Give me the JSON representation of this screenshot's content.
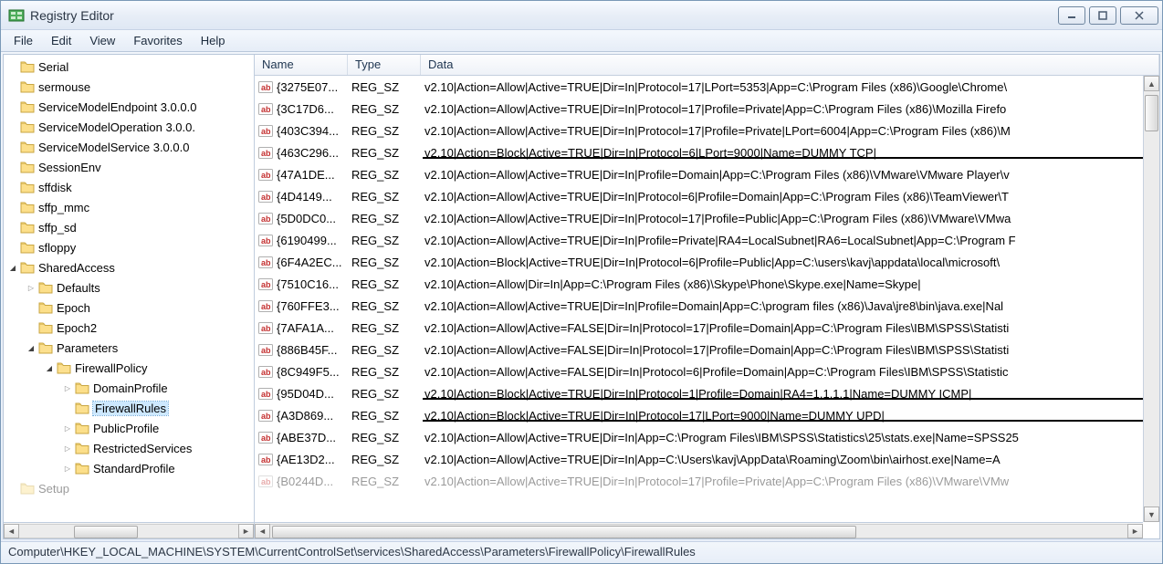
{
  "window": {
    "title": "Registry Editor"
  },
  "menubar": [
    "File",
    "Edit",
    "View",
    "Favorites",
    "Help"
  ],
  "tree": [
    {
      "depth": 1,
      "exp": "",
      "label": "Serial"
    },
    {
      "depth": 1,
      "exp": "",
      "label": "sermouse"
    },
    {
      "depth": 1,
      "exp": "",
      "label": "ServiceModelEndpoint 3.0.0.0"
    },
    {
      "depth": 1,
      "exp": "",
      "label": "ServiceModelOperation 3.0.0."
    },
    {
      "depth": 1,
      "exp": "",
      "label": "ServiceModelService 3.0.0.0"
    },
    {
      "depth": 1,
      "exp": "",
      "label": "SessionEnv"
    },
    {
      "depth": 1,
      "exp": "",
      "label": "sffdisk"
    },
    {
      "depth": 1,
      "exp": "",
      "label": "sffp_mmc"
    },
    {
      "depth": 1,
      "exp": "",
      "label": "sffp_sd"
    },
    {
      "depth": 1,
      "exp": "",
      "label": "sfloppy"
    },
    {
      "depth": 1,
      "exp": "▾",
      "label": "SharedAccess"
    },
    {
      "depth": 2,
      "exp": "▸",
      "label": "Defaults"
    },
    {
      "depth": 2,
      "exp": "",
      "label": "Epoch"
    },
    {
      "depth": 2,
      "exp": "",
      "label": "Epoch2"
    },
    {
      "depth": 2,
      "exp": "▾",
      "label": "Parameters"
    },
    {
      "depth": 3,
      "exp": "▾",
      "label": "FirewallPolicy"
    },
    {
      "depth": 4,
      "exp": "▸",
      "label": "DomainProfile"
    },
    {
      "depth": 4,
      "exp": "",
      "label": "FirewallRules",
      "selected": true
    },
    {
      "depth": 4,
      "exp": "▸",
      "label": "PublicProfile"
    },
    {
      "depth": 4,
      "exp": "▸",
      "label": "RestrictedServices"
    },
    {
      "depth": 4,
      "exp": "▸",
      "label": "StandardProfile"
    },
    {
      "depth": 1,
      "exp": "",
      "label": "Setup",
      "faded": true
    }
  ],
  "list": {
    "columns": [
      "Name",
      "Type",
      "Data"
    ],
    "rows": [
      {
        "name": "{3275E07...",
        "type": "REG_SZ",
        "data": "v2.10|Action=Allow|Active=TRUE|Dir=In|Protocol=17|LPort=5353|App=C:\\Program Files (x86)\\Google\\Chrome\\"
      },
      {
        "name": "{3C17D6...",
        "type": "REG_SZ",
        "data": "v2.10|Action=Allow|Active=TRUE|Dir=In|Protocol=17|Profile=Private|App=C:\\Program Files (x86)\\Mozilla Firefo"
      },
      {
        "name": "{403C394...",
        "type": "REG_SZ",
        "data": "v2.10|Action=Allow|Active=TRUE|Dir=In|Protocol=17|Profile=Private|LPort=6004|App=C:\\Program Files (x86)\\M"
      },
      {
        "name": "{463C296...",
        "type": "REG_SZ",
        "data": "v2.10|Action=Block|Active=TRUE|Dir=In|Protocol=6|LPort=9000|Name=DUMMY TCP|",
        "underlined": true
      },
      {
        "name": "{47A1DE...",
        "type": "REG_SZ",
        "data": "v2.10|Action=Allow|Active=TRUE|Dir=In|Profile=Domain|App=C:\\Program Files (x86)\\VMware\\VMware Player\\v"
      },
      {
        "name": "{4D4149...",
        "type": "REG_SZ",
        "data": "v2.10|Action=Allow|Active=TRUE|Dir=In|Protocol=6|Profile=Domain|App=C:\\Program Files (x86)\\TeamViewer\\T"
      },
      {
        "name": "{5D0DC0...",
        "type": "REG_SZ",
        "data": "v2.10|Action=Allow|Active=TRUE|Dir=In|Protocol=17|Profile=Public|App=C:\\Program Files (x86)\\VMware\\VMwa"
      },
      {
        "name": "{6190499...",
        "type": "REG_SZ",
        "data": "v2.10|Action=Allow|Active=TRUE|Dir=In|Profile=Private|RA4=LocalSubnet|RA6=LocalSubnet|App=C:\\Program F"
      },
      {
        "name": "{6F4A2EC...",
        "type": "REG_SZ",
        "data": "v2.10|Action=Block|Active=TRUE|Dir=In|Protocol=6|Profile=Public|App=C:\\users\\kavj\\appdata\\local\\microsoft\\"
      },
      {
        "name": "{7510C16...",
        "type": "REG_SZ",
        "data": "v2.10|Action=Allow|Dir=In|App=C:\\Program Files (x86)\\Skype\\Phone\\Skype.exe|Name=Skype|"
      },
      {
        "name": "{760FFE3...",
        "type": "REG_SZ",
        "data": "v2.10|Action=Allow|Active=TRUE|Dir=In|Profile=Domain|App=C:\\program files (x86)\\Java\\jre8\\bin\\java.exe|Nal"
      },
      {
        "name": "{7AFA1A...",
        "type": "REG_SZ",
        "data": "v2.10|Action=Allow|Active=FALSE|Dir=In|Protocol=17|Profile=Domain|App=C:\\Program Files\\IBM\\SPSS\\Statisti"
      },
      {
        "name": "{886B45F...",
        "type": "REG_SZ",
        "data": "v2.10|Action=Allow|Active=FALSE|Dir=In|Protocol=17|Profile=Domain|App=C:\\Program Files\\IBM\\SPSS\\Statisti"
      },
      {
        "name": "{8C949F5...",
        "type": "REG_SZ",
        "data": "v2.10|Action=Allow|Active=FALSE|Dir=In|Protocol=6|Profile=Domain|App=C:\\Program Files\\IBM\\SPSS\\Statistic"
      },
      {
        "name": "{95D04D...",
        "type": "REG_SZ",
        "data": "v2.10|Action=Block|Active=TRUE|Dir=In|Protocol=1|Profile=Domain|RA4=1.1.1.1|Name=DUMMY ICMP|",
        "underlined": true
      },
      {
        "name": "{A3D869...",
        "type": "REG_SZ",
        "data": "v2.10|Action=Block|Active=TRUE|Dir=In|Protocol=17|LPort=9000|Name=DUMMY UPD|",
        "underlined": true
      },
      {
        "name": "{ABE37D...",
        "type": "REG_SZ",
        "data": "v2.10|Action=Allow|Active=TRUE|Dir=In|App=C:\\Program Files\\IBM\\SPSS\\Statistics\\25\\stats.exe|Name=SPSS25"
      },
      {
        "name": "{AE13D2...",
        "type": "REG_SZ",
        "data": "v2.10|Action=Allow|Active=TRUE|Dir=In|App=C:\\Users\\kavj\\AppData\\Roaming\\Zoom\\bin\\airhost.exe|Name=A"
      },
      {
        "name": "{B0244D...",
        "type": "REG_SZ",
        "data": "v2.10|Action=Allow|Active=TRUE|Dir=In|Protocol=17|Profile=Private|App=C:\\Program Files (x86)\\VMware\\VMw",
        "faded": true
      }
    ]
  },
  "statusbar": "Computer\\HKEY_LOCAL_MACHINE\\SYSTEM\\CurrentControlSet\\services\\SharedAccess\\Parameters\\FirewallPolicy\\FirewallRules"
}
